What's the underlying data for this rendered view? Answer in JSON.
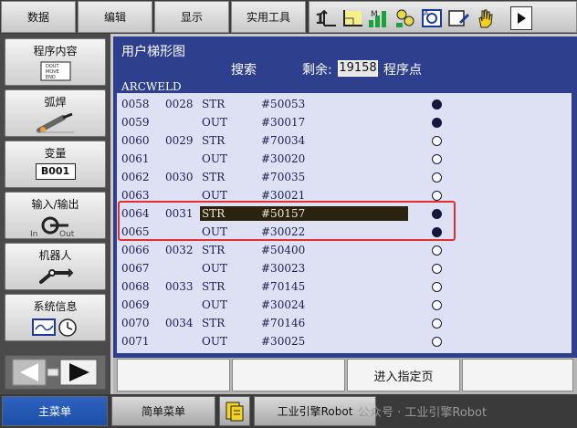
{
  "top_menu": {
    "data": "数据",
    "edit": "编辑",
    "display": "显示",
    "utility": "实用工具"
  },
  "sidebar": {
    "job_content": "程序内容",
    "job_icon_lines": [
      "DOUT",
      "MOVE",
      "END"
    ],
    "arc_weld": "弧焊",
    "variable": "变量",
    "variable_badge": "B001",
    "io": "输入/输出",
    "io_in": "In",
    "io_out": "Out",
    "robot": "机器人",
    "system_info": "系统信息"
  },
  "main": {
    "title": "用户梯形图",
    "search": "搜索",
    "remaining_label": "剩余:",
    "remaining_value": "19158",
    "remaining_unit": "程序点",
    "section": "ARCWELD"
  },
  "ladder_rows": [
    {
      "line": "0058",
      "step": "0028",
      "inst": "STR",
      "addr": "#50053",
      "state": "on"
    },
    {
      "line": "0059",
      "step": "",
      "inst": "OUT",
      "addr": "#30017",
      "state": "on"
    },
    {
      "line": "0060",
      "step": "0029",
      "inst": "STR",
      "addr": "#70034",
      "state": "off"
    },
    {
      "line": "0061",
      "step": "",
      "inst": "OUT",
      "addr": "#30020",
      "state": "off"
    },
    {
      "line": "0062",
      "step": "0030",
      "inst": "STR",
      "addr": "#70035",
      "state": "off"
    },
    {
      "line": "0063",
      "step": "",
      "inst": "OUT",
      "addr": "#30021",
      "state": "off"
    },
    {
      "line": "0064",
      "step": "0031",
      "inst": "STR",
      "addr": "#50157",
      "state": "on",
      "selected": true
    },
    {
      "line": "0065",
      "step": "",
      "inst": "OUT",
      "addr": "#30022",
      "state": "on"
    },
    {
      "line": "0066",
      "step": "0032",
      "inst": "STR",
      "addr": "#50400",
      "state": "off"
    },
    {
      "line": "0067",
      "step": "",
      "inst": "OUT",
      "addr": "#30023",
      "state": "off"
    },
    {
      "line": "0068",
      "step": "0033",
      "inst": "STR",
      "addr": "#70145",
      "state": "off"
    },
    {
      "line": "0069",
      "step": "",
      "inst": "OUT",
      "addr": "#30024",
      "state": "off"
    },
    {
      "line": "0070",
      "step": "0034",
      "inst": "STR",
      "addr": "#70146",
      "state": "off"
    },
    {
      "line": "0071",
      "step": "",
      "inst": "OUT",
      "addr": "#30025",
      "state": "off"
    }
  ],
  "function_strip": {
    "goto_page": "进入指定页"
  },
  "bottom_bar": {
    "main_menu": "主菜单",
    "simple_menu": "简单菜单",
    "status_text": "工业引擎Robot"
  },
  "watermark": "公众号 · 工业引擎Robot",
  "colors": {
    "panel_blue": "#2e3f8e",
    "list_bg": "#dde1f3",
    "highlight": "#2c2210",
    "frame_red": "#e23030",
    "main_menu_blue": "#1c4fa6"
  }
}
